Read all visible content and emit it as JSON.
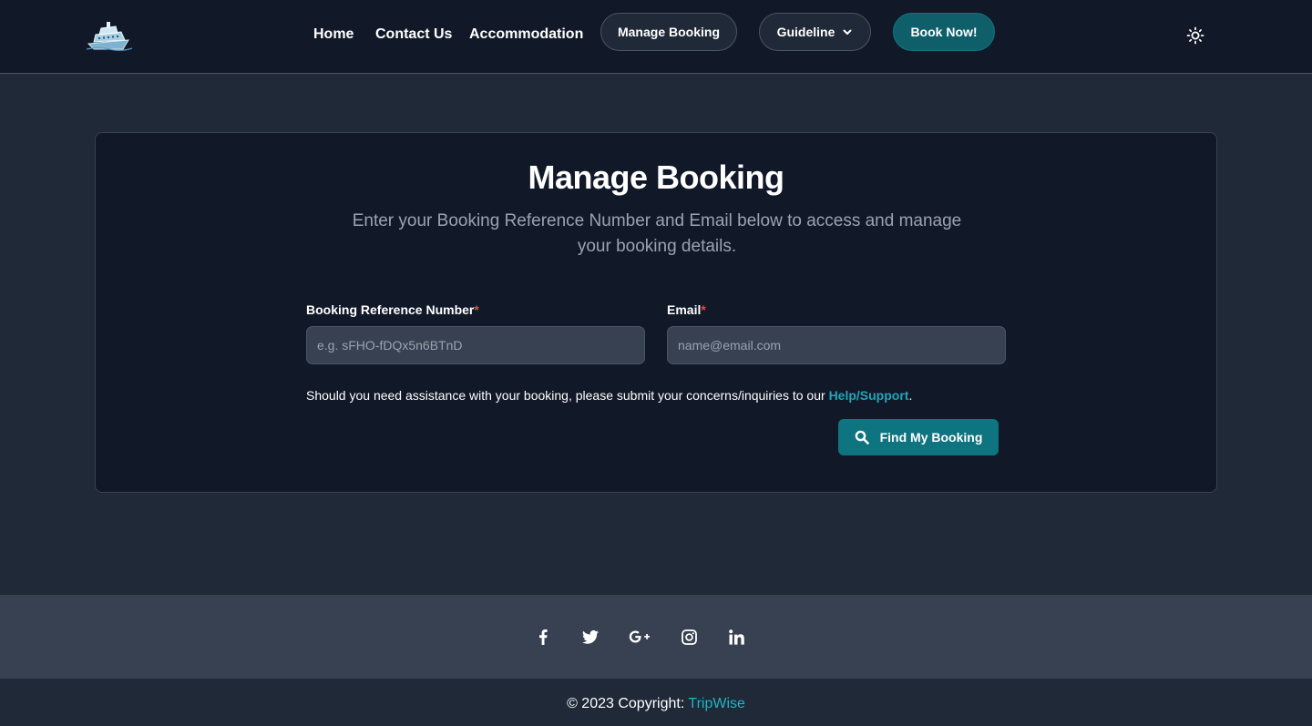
{
  "nav": {
    "logo_icon": "cruise-ship-icon",
    "links": [
      "Home",
      "Contact Us",
      "Accommodation"
    ],
    "manage_booking": "Manage Booking",
    "guideline": "Guideline",
    "book_now": "Book Now!",
    "theme_icon": "sun-icon"
  },
  "card": {
    "title": "Manage Booking",
    "subtitle": "Enter your Booking Reference Number and Email below to access and manage your booking details.",
    "ref_label": "Booking Reference Number",
    "ref_placeholder": "e.g. sFHO-fDQx5n6BTnD",
    "email_label": "Email",
    "email_placeholder": "name@email.com",
    "required_mark": "*",
    "help_text": "Should you need assistance with your booking, please submit your concerns/inquiries to our ",
    "help_link": "Help/Support",
    "help_end": ".",
    "find_button": "Find My Booking"
  },
  "footer": {
    "social_icons": [
      "facebook-icon",
      "twitter-icon",
      "google-plus-icon",
      "instagram-icon",
      "linkedin-icon"
    ],
    "copyright_prefix": "© 2023 Copyright: ",
    "copyright_link": "TripWise"
  },
  "colors": {
    "page_bg": "#1f2937",
    "navbar_bg": "#111827",
    "accent": "#0e7480",
    "link": "#22a6b8",
    "required": "#ef4444"
  }
}
